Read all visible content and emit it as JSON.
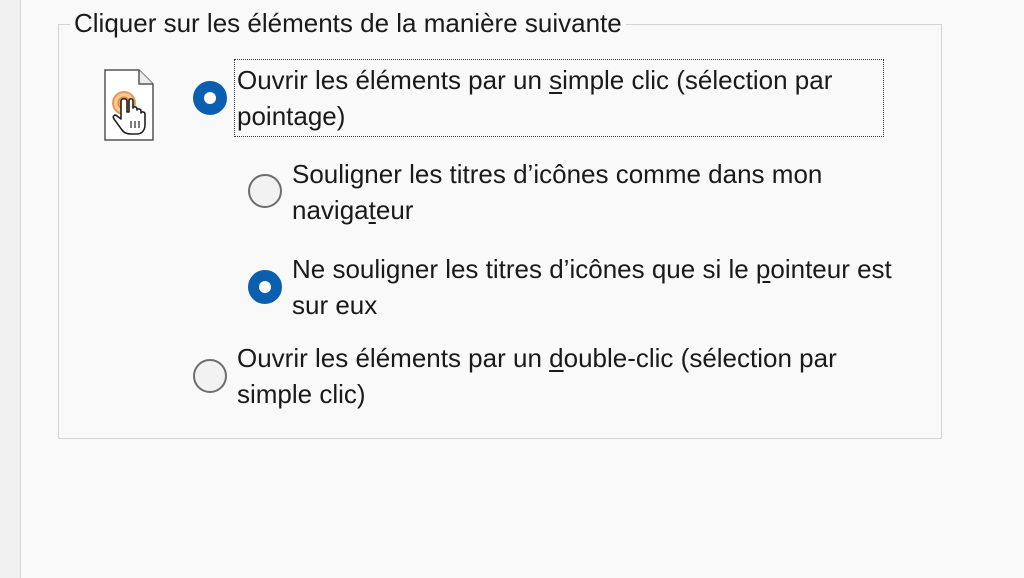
{
  "groupbox": {
    "title": "Cliquer sur les éléments de la manière suivante"
  },
  "options": [
    {
      "id": "single-click",
      "pre": "Ouvrir les éléments par un ",
      "accel": "s",
      "post": "imple clic (sélection par pointage)",
      "checked": true,
      "focused": true
    },
    {
      "id": "underline-like-browser",
      "pre": "Souligner les titres d’icônes comme dans mon naviga",
      "accel": "t",
      "post": "eur",
      "checked": false,
      "focused": false
    },
    {
      "id": "underline-on-hover",
      "pre": "Ne souligner les titres d’icônes que si le ",
      "accel": "p",
      "post": "ointeur est sur eux",
      "checked": true,
      "focused": false
    },
    {
      "id": "double-click",
      "pre": "Ouvrir les éléments par un ",
      "accel": "d",
      "post": "ouble-clic (sélection par simple clic)",
      "checked": false,
      "focused": false
    }
  ],
  "icons": {
    "single_click_illustration": "file-hand-click-icon"
  },
  "colors": {
    "accent": "#0b5fb0",
    "panel_background": "#f9f9f9",
    "window_background": "#f0f0f0",
    "text": "#1a1a1a"
  }
}
